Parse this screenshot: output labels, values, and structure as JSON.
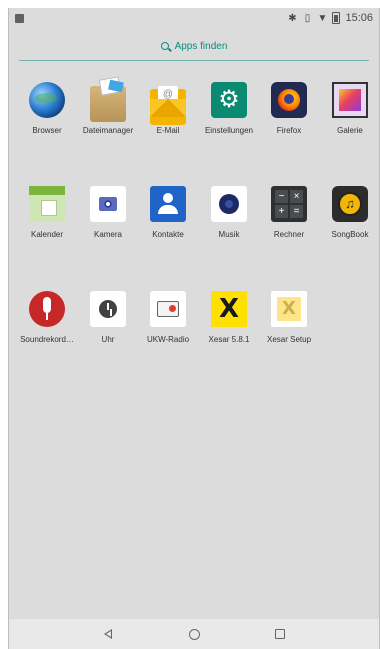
{
  "status_bar": {
    "time": "15:06",
    "icons": [
      "notification-icon",
      "bluetooth-icon",
      "vibrate-icon",
      "wifi-icon",
      "battery-icon"
    ]
  },
  "search": {
    "label": "Apps finden",
    "accent": "#0a8d7e"
  },
  "apps": [
    {
      "label": "Browser",
      "icon": "browser-icon"
    },
    {
      "label": "Dateimanager",
      "icon": "file-manager-icon"
    },
    {
      "label": "E-Mail",
      "icon": "email-icon"
    },
    {
      "label": "Einstellungen",
      "icon": "settings-icon"
    },
    {
      "label": "Firefox",
      "icon": "firefox-icon"
    },
    {
      "label": "Galerie",
      "icon": "gallery-icon"
    },
    {
      "label": "Kalender",
      "icon": "calendar-icon"
    },
    {
      "label": "Kamera",
      "icon": "camera-icon"
    },
    {
      "label": "Kontakte",
      "icon": "contacts-icon"
    },
    {
      "label": "Musik",
      "icon": "music-icon"
    },
    {
      "label": "Rechner",
      "icon": "calculator-icon"
    },
    {
      "label": "SongBook",
      "icon": "songbook-icon"
    },
    {
      "label": "Soundrekord…",
      "icon": "sound-recorder-icon"
    },
    {
      "label": "Uhr",
      "icon": "clock-icon"
    },
    {
      "label": "UKW-Radio",
      "icon": "fm-radio-icon"
    },
    {
      "label": "Xesar 5.8.1",
      "icon": "xesar-icon"
    },
    {
      "label": "Xesar Setup",
      "icon": "xesar-setup-icon"
    }
  ],
  "calc_keys": [
    "−",
    "×",
    "+",
    "="
  ],
  "nav": {
    "back": "back-icon",
    "home": "home-icon",
    "recents": "recents-icon"
  }
}
